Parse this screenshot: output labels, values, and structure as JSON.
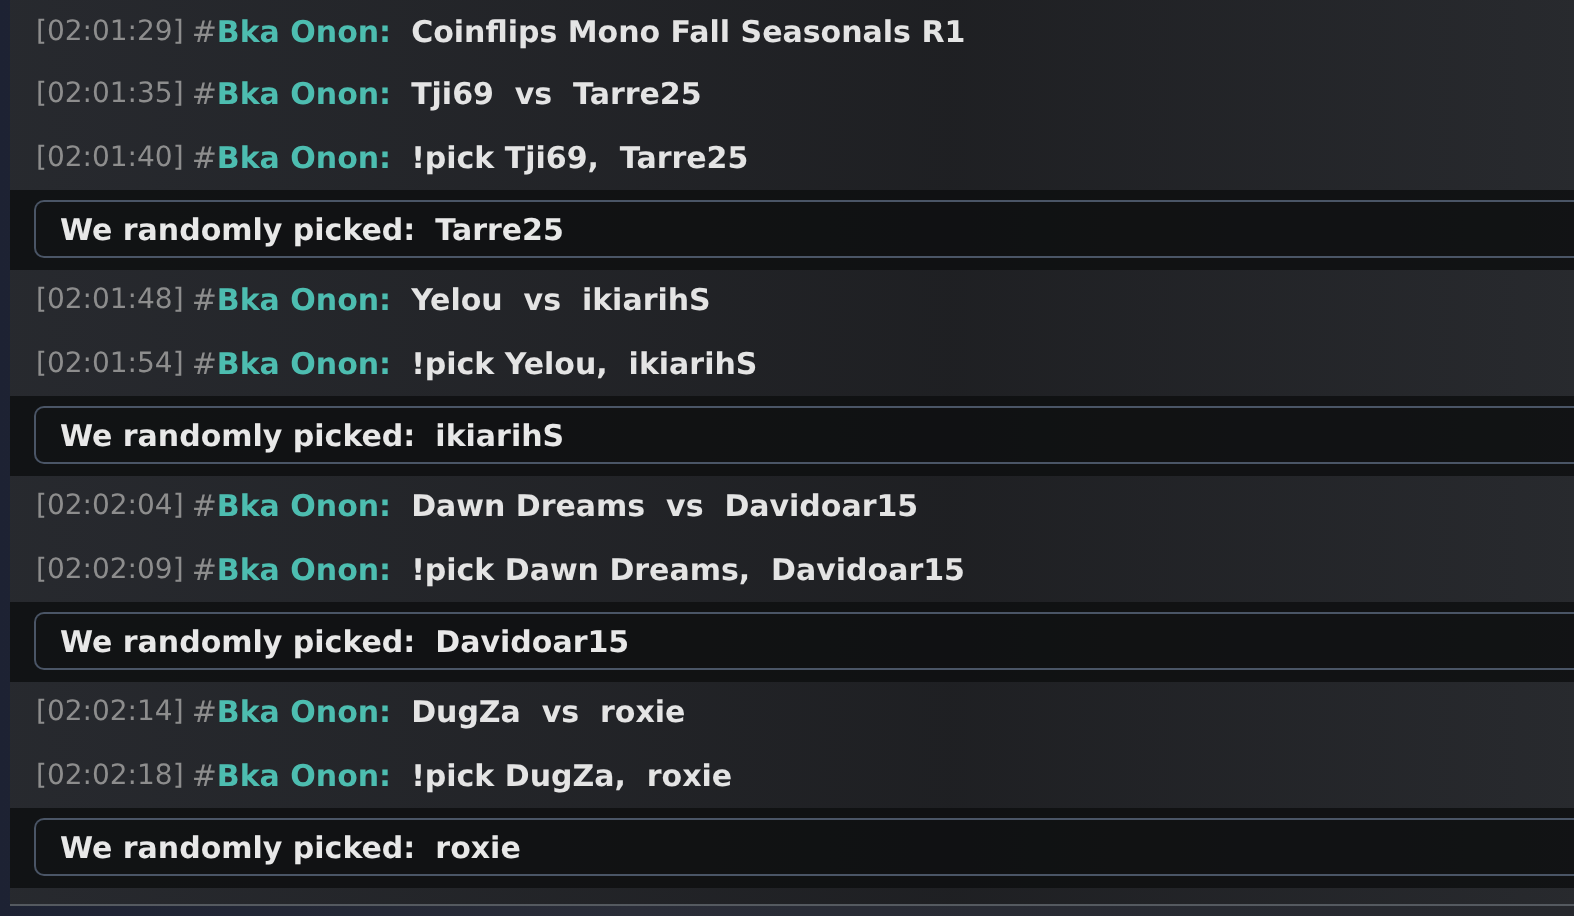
{
  "messages": [
    {
      "kind": "chat",
      "time": "[02:01:29]",
      "prefix": "#",
      "user": "Bka Onon:",
      "text": "Coinflips Mono Fall Seasonals R1"
    },
    {
      "kind": "chat",
      "time": "[02:01:35]",
      "prefix": "#",
      "user": "Bka Onon:",
      "text": "Tji69  vs  Tarre25"
    },
    {
      "kind": "chat",
      "time": "[02:01:40]",
      "prefix": "#",
      "user": "Bka Onon:",
      "text": "!pick Tji69,  Tarre25"
    },
    {
      "kind": "bot",
      "label": "We randomly picked:",
      "value": "Tarre25"
    },
    {
      "kind": "chat",
      "time": "[02:01:48]",
      "prefix": "#",
      "user": "Bka Onon:",
      "text": "Yelou  vs  ikiarihS"
    },
    {
      "kind": "chat",
      "time": "[02:01:54]",
      "prefix": "#",
      "user": "Bka Onon:",
      "text": "!pick Yelou,  ikiarihS"
    },
    {
      "kind": "bot",
      "label": "We randomly picked:",
      "value": "ikiarihS"
    },
    {
      "kind": "chat",
      "time": "[02:02:04]",
      "prefix": "#",
      "user": "Bka Onon:",
      "text": "Dawn Dreams  vs  Davidoar15"
    },
    {
      "kind": "chat",
      "time": "[02:02:09]",
      "prefix": "#",
      "user": "Bka Onon:",
      "text": "!pick Dawn Dreams,  Davidoar15"
    },
    {
      "kind": "bot",
      "label": "We randomly picked:",
      "value": "Davidoar15"
    },
    {
      "kind": "chat",
      "time": "[02:02:14]",
      "prefix": "#",
      "user": "Bka Onon:",
      "text": "DugZa  vs  roxie"
    },
    {
      "kind": "chat",
      "time": "[02:02:18]",
      "prefix": "#",
      "user": "Bka Onon:",
      "text": "!pick DugZa,  roxie"
    },
    {
      "kind": "bot",
      "label": "We randomly picked:",
      "value": "roxie"
    }
  ]
}
